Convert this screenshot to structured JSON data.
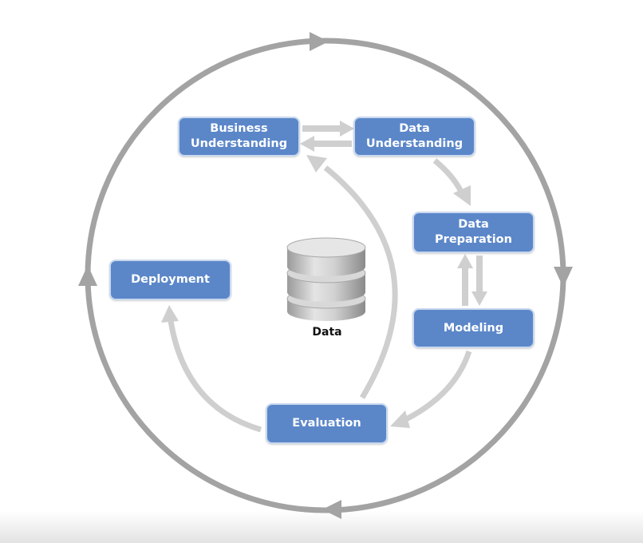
{
  "diagram": {
    "title": "",
    "phases": {
      "business_understanding": "Business\nUnderstanding",
      "data_understanding": "Data\nUnderstanding",
      "data_preparation": "Data\nPreparation",
      "modeling": "Modeling",
      "evaluation": "Evaluation",
      "deployment": "Deployment"
    },
    "center": {
      "label": "Data",
      "icon": "database-icon"
    },
    "colors": {
      "box_fill": "#5b87c9",
      "box_border": "#c9d8ee",
      "outer_cycle": "#a3a3a3",
      "inner_arrows": "#cfcfcf",
      "box_text": "#ffffff"
    }
  }
}
